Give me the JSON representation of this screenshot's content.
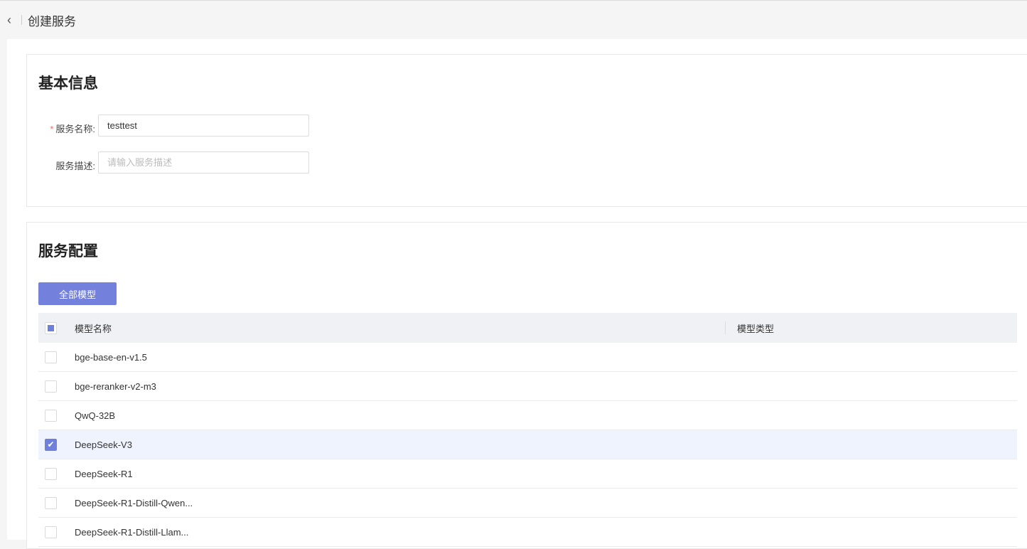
{
  "header": {
    "title": "创建服务"
  },
  "basic": {
    "title": "基本信息",
    "name_label": "服务名称:",
    "name_required": "*",
    "name_value": "testtest",
    "desc_label": "服务描述:",
    "desc_placeholder": "请输入服务描述"
  },
  "config": {
    "title": "服务配置",
    "all_models_button": "全部模型",
    "columns": [
      "模型名称",
      "模型类型"
    ],
    "rows": [
      {
        "name": "bge-base-en-v1.5",
        "checked": false
      },
      {
        "name": "bge-reranker-v2-m3",
        "checked": false
      },
      {
        "name": "QwQ-32B",
        "checked": false
      },
      {
        "name": "DeepSeek-V3",
        "checked": true
      },
      {
        "name": "DeepSeek-R1",
        "checked": false
      },
      {
        "name": "DeepSeek-R1-Distill-Qwen...",
        "checked": false
      },
      {
        "name": "DeepSeek-R1-Distill-Llam...",
        "checked": false
      }
    ]
  },
  "colors": {
    "accent": "#7381dc",
    "selected_row": "#eef3fd"
  }
}
